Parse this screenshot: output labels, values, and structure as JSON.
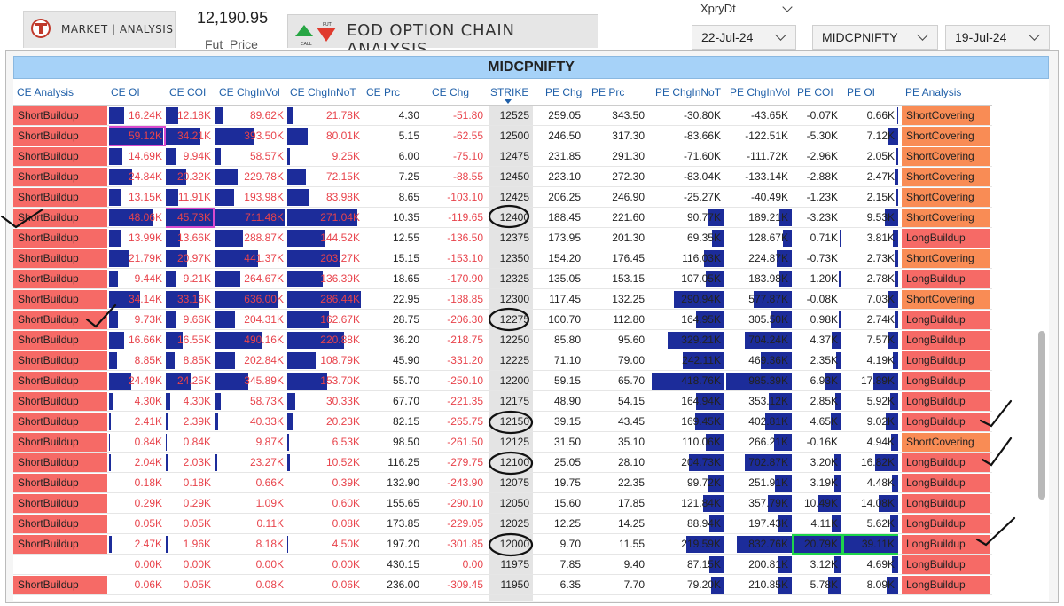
{
  "header": {
    "nav_label": "MARKET | ANALYSIS",
    "fut_price": "12,190.95",
    "fut_price_label": "Fut_Price",
    "title": "EOD OPTION CHAIN ANALYSIS",
    "icon_labels": {
      "call": "CALL",
      "put": "PUT"
    },
    "xpry_label": "XpryDt",
    "expiry_value": "22-Jul-24",
    "symbol_value": "MIDCPNIFTY",
    "date_value": "19-Jul-24"
  },
  "colors": {
    "short_buildup": "#f66a66",
    "long_buildup": "#f66a66",
    "short_covering": "#f98c55",
    "bar": "#1c2c9a",
    "title_bg": "#a6d2f8",
    "header_text": "#1f5fa8",
    "ce_text": "#e8434b"
  },
  "table": {
    "title": "MIDCPNIFTY",
    "columns": [
      "CE Analysis",
      "CE OI",
      "CE COI",
      "CE ChgInVol",
      "CE ChgInNoT",
      "CE Prc",
      "CE Chg",
      "STRIKE",
      "PE Chg",
      "PE Prc",
      "PE ChgInNoT",
      "PE ChgInVol",
      "PE COI",
      "PE OI",
      "PE Analysis"
    ],
    "rows": [
      {
        "ce_an": "ShortBuildup",
        "ce_oi": "16.24K",
        "ce_coi": "12.18K",
        "ce_vol": "89.62K",
        "ce_not": "21.78K",
        "ce_prc": "4.30",
        "ce_chg": "-51.80",
        "strike": "12525",
        "pe_chg": "259.05",
        "pe_prc": "343.50",
        "pe_not": "-30.80K",
        "pe_vol": "-43.65K",
        "pe_coi": "-0.07K",
        "pe_oi": "0.66K",
        "pe_an": "ShortCovering"
      },
      {
        "ce_an": "ShortBuildup",
        "ce_oi": "59.12K",
        "ce_coi": "34.21K",
        "ce_vol": "393.50K",
        "ce_not": "80.01K",
        "ce_prc": "5.15",
        "ce_chg": "-62.55",
        "strike": "12500",
        "pe_chg": "246.50",
        "pe_prc": "317.30",
        "pe_not": "-83.66K",
        "pe_vol": "-122.51K",
        "pe_coi": "-5.30K",
        "pe_oi": "7.12K",
        "pe_an": "ShortCovering"
      },
      {
        "ce_an": "ShortBuildup",
        "ce_oi": "14.69K",
        "ce_coi": "9.94K",
        "ce_vol": "58.57K",
        "ce_not": "9.25K",
        "ce_prc": "6.00",
        "ce_chg": "-75.10",
        "strike": "12475",
        "pe_chg": "231.85",
        "pe_prc": "291.30",
        "pe_not": "-71.60K",
        "pe_vol": "-111.72K",
        "pe_coi": "-2.96K",
        "pe_oi": "2.05K",
        "pe_an": "ShortCovering"
      },
      {
        "ce_an": "ShortBuildup",
        "ce_oi": "24.84K",
        "ce_coi": "20.32K",
        "ce_vol": "229.78K",
        "ce_not": "72.15K",
        "ce_prc": "7.25",
        "ce_chg": "-88.55",
        "strike": "12450",
        "pe_chg": "223.10",
        "pe_prc": "272.30",
        "pe_not": "-83.04K",
        "pe_vol": "-133.14K",
        "pe_coi": "-2.88K",
        "pe_oi": "2.47K",
        "pe_an": "ShortCovering"
      },
      {
        "ce_an": "ShortBuildup",
        "ce_oi": "13.15K",
        "ce_coi": "11.91K",
        "ce_vol": "193.98K",
        "ce_not": "83.98K",
        "ce_prc": "8.65",
        "ce_chg": "-103.10",
        "strike": "12425",
        "pe_chg": "206.25",
        "pe_prc": "246.90",
        "pe_not": "-25.27K",
        "pe_vol": "-40.49K",
        "pe_coi": "-1.23K",
        "pe_oi": "2.15K",
        "pe_an": "ShortCovering"
      },
      {
        "ce_an": "ShortBuildup",
        "ce_oi": "48.06K",
        "ce_coi": "45.73K",
        "ce_vol": "711.48K",
        "ce_not": "271.04K",
        "ce_prc": "10.35",
        "ce_chg": "-119.65",
        "strike": "12400",
        "pe_chg": "188.45",
        "pe_prc": "221.60",
        "pe_not": "90.77K",
        "pe_vol": "189.21K",
        "pe_coi": "-3.23K",
        "pe_oi": "9.53K",
        "pe_an": "ShortCovering"
      },
      {
        "ce_an": "ShortBuildup",
        "ce_oi": "13.99K",
        "ce_coi": "13.66K",
        "ce_vol": "288.87K",
        "ce_not": "144.52K",
        "ce_prc": "12.55",
        "ce_chg": "-136.50",
        "strike": "12375",
        "pe_chg": "173.95",
        "pe_prc": "201.30",
        "pe_not": "69.35K",
        "pe_vol": "128.67K",
        "pe_coi": "0.71K",
        "pe_oi": "3.81K",
        "pe_an": "LongBuildup"
      },
      {
        "ce_an": "ShortBuildup",
        "ce_oi": "21.79K",
        "ce_coi": "20.97K",
        "ce_vol": "441.37K",
        "ce_not": "203.27K",
        "ce_prc": "15.15",
        "ce_chg": "-153.10",
        "strike": "12350",
        "pe_chg": "154.20",
        "pe_prc": "176.45",
        "pe_not": "116.03K",
        "pe_vol": "224.87K",
        "pe_coi": "-0.73K",
        "pe_oi": "2.73K",
        "pe_an": "ShortCovering"
      },
      {
        "ce_an": "ShortBuildup",
        "ce_oi": "9.44K",
        "ce_coi": "9.21K",
        "ce_vol": "264.67K",
        "ce_not": "136.39K",
        "ce_prc": "18.65",
        "ce_chg": "-170.90",
        "strike": "12325",
        "pe_chg": "135.05",
        "pe_prc": "153.15",
        "pe_not": "107.05K",
        "pe_vol": "183.98K",
        "pe_coi": "1.20K",
        "pe_oi": "2.78K",
        "pe_an": "LongBuildup"
      },
      {
        "ce_an": "ShortBuildup",
        "ce_oi": "34.14K",
        "ce_coi": "33.16K",
        "ce_vol": "636.00K",
        "ce_not": "286.44K",
        "ce_prc": "22.95",
        "ce_chg": "-188.85",
        "strike": "12300",
        "pe_chg": "117.45",
        "pe_prc": "132.25",
        "pe_not": "290.94K",
        "pe_vol": "577.87K",
        "pe_coi": "-0.08K",
        "pe_oi": "7.03K",
        "pe_an": "ShortCovering"
      },
      {
        "ce_an": "ShortBuildup",
        "ce_oi": "9.73K",
        "ce_coi": "9.66K",
        "ce_vol": "204.31K",
        "ce_not": "162.67K",
        "ce_prc": "28.75",
        "ce_chg": "-206.30",
        "strike": "12275",
        "pe_chg": "100.70",
        "pe_prc": "112.80",
        "pe_not": "164.95K",
        "pe_vol": "305.50K",
        "pe_coi": "0.98K",
        "pe_oi": "2.74K",
        "pe_an": "LongBuildup"
      },
      {
        "ce_an": "ShortBuildup",
        "ce_oi": "16.66K",
        "ce_coi": "16.55K",
        "ce_vol": "490.16K",
        "ce_not": "220.88K",
        "ce_prc": "36.20",
        "ce_chg": "-218.75",
        "strike": "12250",
        "pe_chg": "85.80",
        "pe_prc": "95.60",
        "pe_not": "329.21K",
        "pe_vol": "704.24K",
        "pe_coi": "4.37K",
        "pe_oi": "7.57K",
        "pe_an": "LongBuildup"
      },
      {
        "ce_an": "ShortBuildup",
        "ce_oi": "8.85K",
        "ce_coi": "8.85K",
        "ce_vol": "202.84K",
        "ce_not": "108.79K",
        "ce_prc": "45.90",
        "ce_chg": "-331.20",
        "strike": "12225",
        "pe_chg": "71.10",
        "pe_prc": "79.00",
        "pe_not": "242.11K",
        "pe_vol": "469.36K",
        "pe_coi": "2.35K",
        "pe_oi": "4.19K",
        "pe_an": "LongBuildup"
      },
      {
        "ce_an": "ShortBuildup",
        "ce_oi": "24.49K",
        "ce_coi": "24.25K",
        "ce_vol": "345.89K",
        "ce_not": "153.70K",
        "ce_prc": "55.70",
        "ce_chg": "-250.10",
        "strike": "12200",
        "pe_chg": "59.15",
        "pe_prc": "65.70",
        "pe_not": "418.76K",
        "pe_vol": "985.39K",
        "pe_coi": "6.93K",
        "pe_oi": "17.89K",
        "pe_an": "LongBuildup"
      },
      {
        "ce_an": "ShortBuildup",
        "ce_oi": "4.30K",
        "ce_coi": "4.30K",
        "ce_vol": "58.73K",
        "ce_not": "30.33K",
        "ce_prc": "67.70",
        "ce_chg": "-221.35",
        "strike": "12175",
        "pe_chg": "48.90",
        "pe_prc": "54.15",
        "pe_not": "164.94K",
        "pe_vol": "353.12K",
        "pe_coi": "2.85K",
        "pe_oi": "5.92K",
        "pe_an": "LongBuildup"
      },
      {
        "ce_an": "ShortBuildup",
        "ce_oi": "2.41K",
        "ce_coi": "2.39K",
        "ce_vol": "40.33K",
        "ce_not": "20.23K",
        "ce_prc": "82.15",
        "ce_chg": "-265.75",
        "strike": "12150",
        "pe_chg": "39.15",
        "pe_prc": "43.45",
        "pe_not": "169.45K",
        "pe_vol": "402.81K",
        "pe_coi": "4.65K",
        "pe_oi": "9.02K",
        "pe_an": "LongBuildup"
      },
      {
        "ce_an": "ShortBuildup",
        "ce_oi": "0.84K",
        "ce_coi": "0.84K",
        "ce_vol": "9.87K",
        "ce_not": "6.53K",
        "ce_prc": "98.50",
        "ce_chg": "-261.50",
        "strike": "12125",
        "pe_chg": "31.50",
        "pe_prc": "35.10",
        "pe_not": "110.06K",
        "pe_vol": "266.21K",
        "pe_coi": "-0.16K",
        "pe_oi": "4.94K",
        "pe_an": "ShortCovering"
      },
      {
        "ce_an": "ShortBuildup",
        "ce_oi": "2.04K",
        "ce_coi": "2.03K",
        "ce_vol": "23.27K",
        "ce_not": "10.52K",
        "ce_prc": "116.25",
        "ce_chg": "-279.75",
        "strike": "12100",
        "pe_chg": "25.05",
        "pe_prc": "28.10",
        "pe_not": "204.73K",
        "pe_vol": "702.87K",
        "pe_coi": "3.20K",
        "pe_oi": "16.82K",
        "pe_an": "LongBuildup"
      },
      {
        "ce_an": "ShortBuildup",
        "ce_oi": "0.18K",
        "ce_coi": "0.18K",
        "ce_vol": "0.66K",
        "ce_not": "0.39K",
        "ce_prc": "132.90",
        "ce_chg": "-243.90",
        "strike": "12075",
        "pe_chg": "19.75",
        "pe_prc": "22.35",
        "pe_not": "99.72K",
        "pe_vol": "251.91K",
        "pe_coi": "3.19K",
        "pe_oi": "4.48K",
        "pe_an": "LongBuildup"
      },
      {
        "ce_an": "ShortBuildup",
        "ce_oi": "0.29K",
        "ce_coi": "0.29K",
        "ce_vol": "1.09K",
        "ce_not": "0.60K",
        "ce_prc": "155.65",
        "ce_chg": "-290.10",
        "strike": "12050",
        "pe_chg": "15.60",
        "pe_prc": "17.85",
        "pe_not": "121.84K",
        "pe_vol": "357.79K",
        "pe_coi": "10.49K",
        "pe_oi": "14.08K",
        "pe_an": "LongBuildup"
      },
      {
        "ce_an": "ShortBuildup",
        "ce_oi": "0.05K",
        "ce_coi": "0.05K",
        "ce_vol": "0.11K",
        "ce_not": "0.08K",
        "ce_prc": "173.85",
        "ce_chg": "-229.05",
        "strike": "12025",
        "pe_chg": "12.25",
        "pe_prc": "14.25",
        "pe_not": "88.94K",
        "pe_vol": "197.43K",
        "pe_coi": "4.11K",
        "pe_oi": "5.62K",
        "pe_an": "LongBuildup"
      },
      {
        "ce_an": "ShortBuildup",
        "ce_oi": "2.47K",
        "ce_coi": "1.96K",
        "ce_vol": "8.18K",
        "ce_not": "4.50K",
        "ce_prc": "197.20",
        "ce_chg": "-301.85",
        "strike": "12000",
        "pe_chg": "9.70",
        "pe_prc": "11.55",
        "pe_not": "219.59K",
        "pe_vol": "832.76K",
        "pe_coi": "20.79K",
        "pe_oi": "39.11K",
        "pe_an": "LongBuildup"
      },
      {
        "ce_an": "",
        "ce_oi": "0.00K",
        "ce_coi": "0.00K",
        "ce_vol": "0.00K",
        "ce_not": "0.00K",
        "ce_prc": "430.15",
        "ce_chg": "0.00",
        "strike": "11975",
        "pe_chg": "7.85",
        "pe_prc": "9.40",
        "pe_not": "87.15K",
        "pe_vol": "200.81K",
        "pe_coi": "3.12K",
        "pe_oi": "4.69K",
        "pe_an": "LongBuildup"
      },
      {
        "ce_an": "ShortBuildup",
        "ce_oi": "0.06K",
        "ce_coi": "0.05K",
        "ce_vol": "0.08K",
        "ce_not": "0.06K",
        "ce_prc": "236.00",
        "ce_chg": "-309.45",
        "strike": "11950",
        "pe_chg": "6.35",
        "pe_prc": "7.70",
        "pe_not": "79.20K",
        "pe_vol": "210.85K",
        "pe_coi": "5.78K",
        "pe_oi": "8.09K",
        "pe_an": "LongBuildup"
      }
    ]
  }
}
